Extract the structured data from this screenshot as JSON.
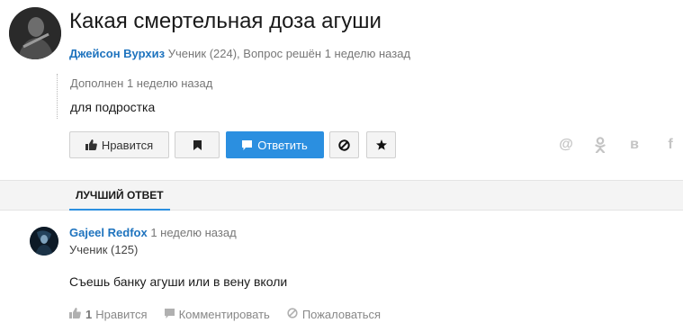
{
  "question": {
    "title": "Какая смертельная доза агуши",
    "author": "Джейсон Вурхиз",
    "meta": "Ученик (224), Вопрос решён 1 неделю назад",
    "addition_meta": "Дополнен 1 неделю назад",
    "addition_text": "для подростка"
  },
  "actions": {
    "like_label": "Нравится",
    "answer_label": "Ответить",
    "icons": [
      "thumb-up-icon",
      "bookmark-icon",
      "reply-icon",
      "block-icon",
      "star-icon"
    ]
  },
  "share": {
    "mail": "@",
    "ok": "ок",
    "vk": "в",
    "fb": "f"
  },
  "best_answer": {
    "tab_label": "ЛУЧШИЙ ОТВЕТ",
    "author": "Gajeel Redfox",
    "time": "1 неделю назад",
    "rank": "Ученик (125)",
    "text": "Съешь банку агуши или в вену вколи",
    "like_count": "1",
    "like_label": "Нравится",
    "comment_label": "Комментировать",
    "report_label": "Пожаловаться"
  },
  "colors": {
    "accent": "#2b8fe0",
    "link": "#1e73be",
    "muted": "#777777"
  }
}
